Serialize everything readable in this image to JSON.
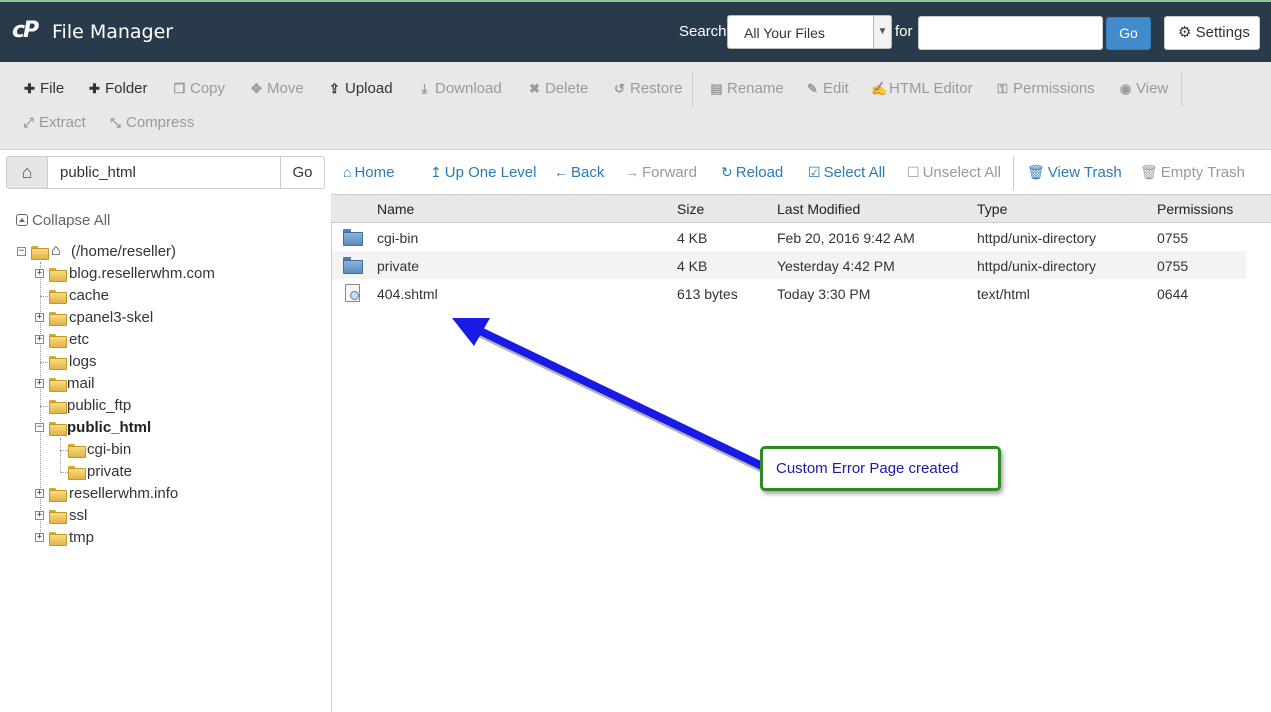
{
  "header": {
    "app_title": "File Manager",
    "search_label": "Search",
    "search_scope": "All Your Files",
    "for_label": "for",
    "search_value": "",
    "go_label": "Go",
    "settings_label": "Settings"
  },
  "toolbar": {
    "row1": [
      {
        "label": "File",
        "icon": "plus-icon",
        "enabled": true
      },
      {
        "label": "Folder",
        "icon": "plus-icon",
        "enabled": true
      },
      {
        "label": "Copy",
        "icon": "copy-icon",
        "enabled": false
      },
      {
        "label": "Move",
        "icon": "move-icon",
        "enabled": false
      },
      {
        "label": "Upload",
        "icon": "upload-icon",
        "enabled": true
      },
      {
        "label": "Download",
        "icon": "download-icon",
        "enabled": false
      },
      {
        "label": "Delete",
        "icon": "delete-icon",
        "enabled": false
      },
      {
        "label": "Restore",
        "icon": "restore-icon",
        "enabled": false
      },
      {
        "label": "Rename",
        "icon": "file-icon",
        "enabled": false
      },
      {
        "label": "Edit",
        "icon": "pencil-icon",
        "enabled": false
      },
      {
        "label": "HTML Editor",
        "icon": "edit-box-icon",
        "enabled": false
      },
      {
        "label": "Permissions",
        "icon": "key-icon",
        "enabled": false
      },
      {
        "label": "View",
        "icon": "eye-icon",
        "enabled": false
      }
    ],
    "row2": [
      {
        "label": "Extract",
        "icon": "expand-icon",
        "enabled": false
      },
      {
        "label": "Compress",
        "icon": "compress-icon",
        "enabled": false
      }
    ]
  },
  "path": {
    "value": "public_html",
    "go_label": "Go"
  },
  "nav": [
    {
      "label": "Home",
      "icon": "home-icon",
      "enabled": true
    },
    {
      "label": "Up One Level",
      "icon": "level-up-icon",
      "enabled": true
    },
    {
      "label": "Back",
      "icon": "arrow-left-icon",
      "enabled": true
    },
    {
      "label": "Forward",
      "icon": "arrow-right-icon",
      "enabled": false
    },
    {
      "label": "Reload",
      "icon": "reload-icon",
      "enabled": true
    },
    {
      "label": "Select All",
      "icon": "checkbox-checked-icon",
      "enabled": true
    },
    {
      "label": "Unselect All",
      "icon": "checkbox-empty-icon",
      "enabled": false
    },
    {
      "label": "View Trash",
      "icon": "trash-icon",
      "enabled": true
    },
    {
      "label": "Empty Trash",
      "icon": "trash-icon",
      "enabled": false
    }
  ],
  "tree": {
    "collapse_label": "Collapse All",
    "root_label": "(/home/reseller)",
    "items": [
      {
        "label": "blog.resellerwhm.com",
        "expandable": true
      },
      {
        "label": "cache",
        "expandable": false
      },
      {
        "label": "cpanel3-skel",
        "expandable": true
      },
      {
        "label": "etc",
        "expandable": true
      },
      {
        "label": "logs",
        "expandable": false
      },
      {
        "label": "mail",
        "expandable": true
      },
      {
        "label": "public_ftp",
        "expandable": false
      },
      {
        "label": "public_html",
        "expandable": true,
        "selected": true
      },
      {
        "label": "cgi-bin",
        "child": true
      },
      {
        "label": "private",
        "child": true
      },
      {
        "label": "resellerwhm.info",
        "expandable": true
      },
      {
        "label": "ssl",
        "expandable": true
      },
      {
        "label": "tmp",
        "expandable": true
      }
    ]
  },
  "table": {
    "columns": [
      "Name",
      "Size",
      "Last Modified",
      "Type",
      "Permissions"
    ],
    "rows": [
      {
        "name": "cgi-bin",
        "size": "4 KB",
        "modified": "Feb 20, 2016 9:42 AM",
        "type": "httpd/unix-directory",
        "perms": "0755",
        "icon": "folder-icon"
      },
      {
        "name": "private",
        "size": "4 KB",
        "modified": "Yesterday 4:42 PM",
        "type": "httpd/unix-directory",
        "perms": "0755",
        "icon": "folder-icon"
      },
      {
        "name": "404.shtml",
        "size": "613 bytes",
        "modified": "Today 3:30 PM",
        "type": "text/html",
        "perms": "0644",
        "icon": "html-file-icon"
      }
    ]
  },
  "callout": {
    "text": "Custom Error Page created"
  }
}
